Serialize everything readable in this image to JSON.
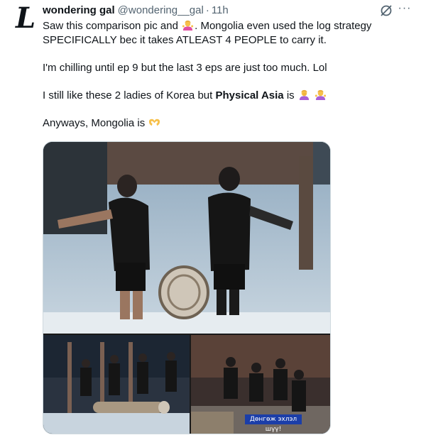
{
  "tweet": {
    "avatar_letter": "L",
    "display_name": "wondering gal",
    "handle": "@wondering__gal",
    "separator": "·",
    "time": "11h",
    "more_label": "···",
    "line1_a": "Saw this comparison pic and",
    "line1_b": ". Mongolia even used the log strategy SPECIFICALLY bec it takes ATLEAST 4 PEOPLE to carry it.",
    "line2": "I'm chilling until ep 9 but the last 3 eps are just too much. Lol",
    "line3_a": "I still like these 2 ladies of Korea but",
    "line3_bold": "Physical Asia",
    "line3_b": "is",
    "line4": "Anyways, Mongolia is",
    "emojis": [
      "person-shrugging-icon",
      "person-facepalming-icon",
      "person-shrugging-icon",
      "heart-hands-icon"
    ]
  },
  "media": {
    "subtitle_text": "Дөнгөж эхлэл шүү!"
  },
  "colors": {
    "text": "#0f1419",
    "secondary": "#536471",
    "border": "#cfd9de",
    "caption_bg": "#1b3ea8"
  }
}
